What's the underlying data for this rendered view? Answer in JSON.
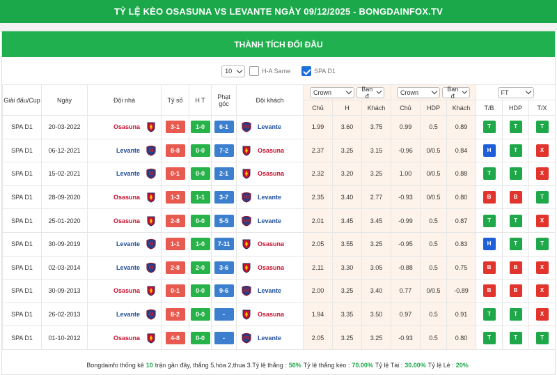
{
  "banner": {
    "title": "TỶ LỆ KÈO OSASUNA VS LEVANTE NGÀY 09/12/2025 - BONGDAINFOX.TV"
  },
  "section": {
    "title": "THÀNH TÍCH ĐỐI ĐẦU"
  },
  "controls": {
    "count_value": "10",
    "ha_same_label": "H-A Same",
    "ha_same_checked": false,
    "spa_label": "SPA D1",
    "spa_checked": true
  },
  "headers": {
    "league": "Giải đấu/Cup",
    "date": "Ngày",
    "home": "Đội nhà",
    "score": "Tỷ số",
    "ht": "H T",
    "corner": "Phạt góc",
    "away": "Đội khách",
    "odds1_sel_a": "Crown",
    "odds1_sel_b": "Ban đ",
    "odds2_sel_a": "Crown",
    "odds2_sel_b": "Ban đ",
    "ft_sel": "FT",
    "sub": [
      "Chủ",
      "H",
      "Khách",
      "Chủ",
      "HDP",
      "Khách",
      "T/B",
      "HDP",
      "T/X"
    ]
  },
  "rows": [
    {
      "league": "SPA D1",
      "date": "20-03-2022",
      "home": "Osasuna",
      "score": "3-1",
      "ht": "1-0",
      "corner": "6-1",
      "away": "Levante",
      "o1": "1.99",
      "o2": "3.60",
      "o3": "3.75",
      "h1": "0.99",
      "h2": "0.5",
      "h3": "0.89",
      "r1": "T",
      "r2": "T",
      "r3": "T"
    },
    {
      "league": "SPA D1",
      "date": "06-12-2021",
      "home": "Levante",
      "score": "8-8",
      "ht": "0-0",
      "corner": "7-2",
      "away": "Osasuna",
      "o1": "2.37",
      "o2": "3.25",
      "o3": "3.15",
      "h1": "-0.96",
      "h2": "0/0.5",
      "h3": "0.84",
      "r1": "H",
      "r2": "T",
      "r3": "X"
    },
    {
      "league": "SPA D1",
      "date": "15-02-2021",
      "home": "Levante",
      "score": "0-1",
      "ht": "0-0",
      "corner": "2-1",
      "away": "Osasuna",
      "o1": "2.32",
      "o2": "3.20",
      "o3": "3.25",
      "h1": "1.00",
      "h2": "0/0.5",
      "h3": "0.88",
      "r1": "T",
      "r2": "T",
      "r3": "X"
    },
    {
      "league": "SPA D1",
      "date": "28-09-2020",
      "home": "Osasuna",
      "score": "1-3",
      "ht": "1-1",
      "corner": "3-7",
      "away": "Levante",
      "o1": "2.35",
      "o2": "3.40",
      "o3": "2.77",
      "h1": "-0.93",
      "h2": "0/0.5",
      "h3": "0.80",
      "r1": "B",
      "r2": "B",
      "r3": "T"
    },
    {
      "league": "SPA D1",
      "date": "25-01-2020",
      "home": "Osasuna",
      "score": "2-8",
      "ht": "0-0",
      "corner": "5-5",
      "away": "Levante",
      "o1": "2.01",
      "o2": "3.45",
      "o3": "3.45",
      "h1": "-0.99",
      "h2": "0.5",
      "h3": "0.87",
      "r1": "T",
      "r2": "T",
      "r3": "X"
    },
    {
      "league": "SPA D1",
      "date": "30-09-2019",
      "home": "Levante",
      "score": "1-1",
      "ht": "1-0",
      "corner": "7-11",
      "away": "Osasuna",
      "o1": "2.05",
      "o2": "3.55",
      "o3": "3.25",
      "h1": "-0.95",
      "h2": "0.5",
      "h3": "0.83",
      "r1": "H",
      "r2": "T",
      "r3": "T"
    },
    {
      "league": "SPA D1",
      "date": "02-03-2014",
      "home": "Levante",
      "score": "2-8",
      "ht": "2-0",
      "corner": "3-6",
      "away": "Osasuna",
      "o1": "2.11",
      "o2": "3.30",
      "o3": "3.05",
      "h1": "-0.88",
      "h2": "0.5",
      "h3": "0.75",
      "r1": "B",
      "r2": "B",
      "r3": "X"
    },
    {
      "league": "SPA D1",
      "date": "30-09-2013",
      "home": "Osasuna",
      "score": "0-1",
      "ht": "0-0",
      "corner": "9-6",
      "away": "Levante",
      "o1": "2.00",
      "o2": "3.25",
      "o3": "3.40",
      "h1": "0.77",
      "h2": "0/0.5",
      "h3": "-0.89",
      "r1": "B",
      "r2": "B",
      "r3": "X"
    },
    {
      "league": "SPA D1",
      "date": "26-02-2013",
      "home": "Levante",
      "score": "8-2",
      "ht": "0-0",
      "corner": "-",
      "away": "Osasuna",
      "o1": "1.94",
      "o2": "3.35",
      "o3": "3.50",
      "h1": "0.97",
      "h2": "0.5",
      "h3": "0.91",
      "r1": "T",
      "r2": "T",
      "r3": "X"
    },
    {
      "league": "SPA D1",
      "date": "01-10-2012",
      "home": "Osasuna",
      "score": "4-8",
      "ht": "0-0",
      "corner": "-",
      "away": "Levante",
      "o1": "2.05",
      "o2": "3.25",
      "o3": "3.25",
      "h1": "-0.93",
      "h2": "0.5",
      "h3": "0.80",
      "r1": "T",
      "r2": "T",
      "r3": "T"
    }
  ],
  "footer": {
    "t1": "Bongdainfo thống kê",
    "n": "10",
    "t2": "trận gần đây, thắng 5,hòa 2,thua 3.Tỷ lệ thắng :",
    "win": "50%",
    "t3": "Tỷ lệ thắng kèo :",
    "hdp": "70.00%",
    "t4": "Tỷ lệ Tài :",
    "over": "30.00%",
    "t5": "Tỷ lệ Lẻ :",
    "odd": "20%"
  },
  "colors": {
    "green": "#21b04f",
    "red": "#e0342c",
    "blue": "#1e5fd9",
    "odds_bg": "#fdf3ea"
  }
}
